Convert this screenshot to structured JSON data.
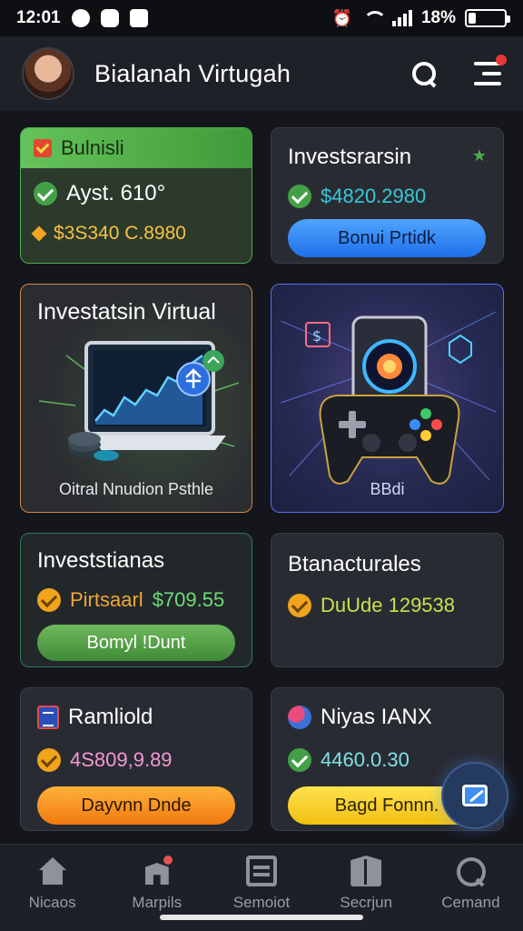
{
  "status_bar": {
    "time": "12:01",
    "battery": "18%"
  },
  "header": {
    "title": "Bialanah Virtugah"
  },
  "cards": {
    "budget": {
      "title": "Bulnisli",
      "line1": "Ayst. 610°",
      "line2": "$3S340 C.8980"
    },
    "invest": {
      "title": "Investsrarsin",
      "value": "$4820.2980",
      "button": "Bonui Prtidk"
    },
    "virtual": {
      "title": "Investatsin Virtual",
      "caption": "Oitral Nnudion Psthle"
    },
    "game": {
      "caption": "BBdi"
    },
    "investments": {
      "title": "Investstianas",
      "label": "Pirtsaarl",
      "amount": "$709.55",
      "button": "Bomyl !Dunt"
    },
    "branch": {
      "title": "Btanacturales",
      "value": "DuUde 129538"
    },
    "ramblings": {
      "title": "Ramliold",
      "value": "4S809,9.89",
      "button": "Dayvnn Dnde"
    },
    "nivas": {
      "title": "Niyas IANX",
      "value": "4460.0.30",
      "button": "Bagd Fonnn."
    }
  },
  "nav": [
    {
      "label": "Nicaos",
      "icon": "home-icon"
    },
    {
      "label": "Marpils",
      "icon": "map-icon"
    },
    {
      "label": "Semoiot",
      "icon": "document-icon"
    },
    {
      "label": "Secrjun",
      "icon": "book-icon"
    },
    {
      "label": "Cemand",
      "icon": "search-icon"
    }
  ],
  "colors": {
    "accent_green": "#4caf50",
    "accent_blue": "#1f6fe8",
    "background": "#15161b"
  }
}
